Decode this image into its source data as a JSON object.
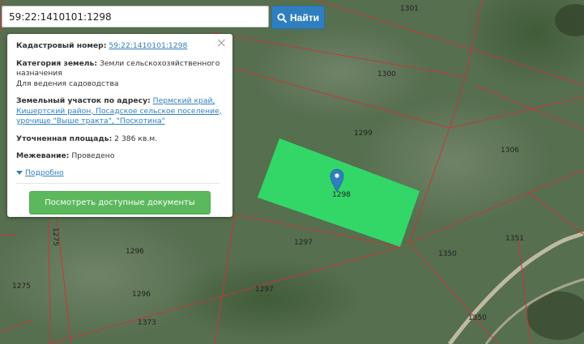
{
  "search": {
    "value": "59:22:1410101:1298",
    "button_label": "Найти",
    "icon": "search-icon"
  },
  "popup": {
    "close_symbol": "×",
    "cadastral_label": "Кадастровый номер:",
    "cadastral_number": "59:22:1410101:1298",
    "category_label": "Категория земель:",
    "category_value": "Земли сельскохозяйственного назначения",
    "purpose": "Для ведения садоводства",
    "address_label": "Земельный участок по адресу:",
    "address_value": "Пермский край, Кишертский район, Посадское сельское поселение, урочище \"Выше тракта\", \"Поскотина\"",
    "area_label": "Уточненная площадь:",
    "area_value": "2 386 кв.м.",
    "survey_label": "Межевание:",
    "survey_value": "Проведено",
    "more_label": "Подробно",
    "docs_button": "Посмотреть доступные документы"
  },
  "map": {
    "selected_marker_label": "1298",
    "parcel_labels": [
      "1301",
      "1300",
      "1299",
      "1306",
      "1297",
      "1297",
      "1296",
      "1296",
      "1275",
      "1275",
      "1373",
      "1350",
      "1350",
      "1351"
    ],
    "colors": {
      "selected_fill": "#2fe06a",
      "boundary": "#c0393b",
      "marker": "#2f7fc0"
    }
  }
}
